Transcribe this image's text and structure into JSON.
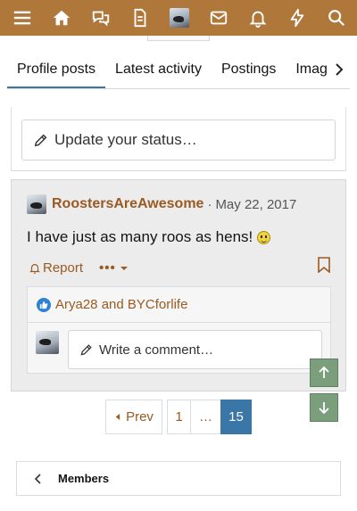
{
  "colors": {
    "header_bg": "#b0773a",
    "accent_blue": "#3a76a6",
    "link_brown": "#9a5a22",
    "scroll_button_green": "#7b9f7d",
    "post_bg": "#ececec"
  },
  "header": {
    "icons": [
      "menu-icon",
      "home-icon",
      "chat-bubbles-icon",
      "document-icon",
      "user-avatar",
      "envelope-icon",
      "bell-icon",
      "lightning-icon",
      "search-icon"
    ]
  },
  "tabs": [
    {
      "label": "Profile posts",
      "active": true
    },
    {
      "label": "Latest activity",
      "active": false
    },
    {
      "label": "Postings",
      "active": false
    },
    {
      "label": "Imag",
      "active": false
    }
  ],
  "status": {
    "placeholder": "Update your status…"
  },
  "post": {
    "author": "RoostersAreAwesome",
    "separator": "·",
    "date": "May 22, 2017",
    "text": "I have just as many roos as hens!",
    "report_label": "Report",
    "more_label": "•••",
    "reactions": "Arya28 and BYCforlife",
    "comment_placeholder": "Write a comment…"
  },
  "pagination": {
    "prev_label": "Prev",
    "pages": [
      "1",
      "…",
      "15"
    ],
    "current": "15"
  },
  "footer": {
    "members_label": "Members"
  }
}
